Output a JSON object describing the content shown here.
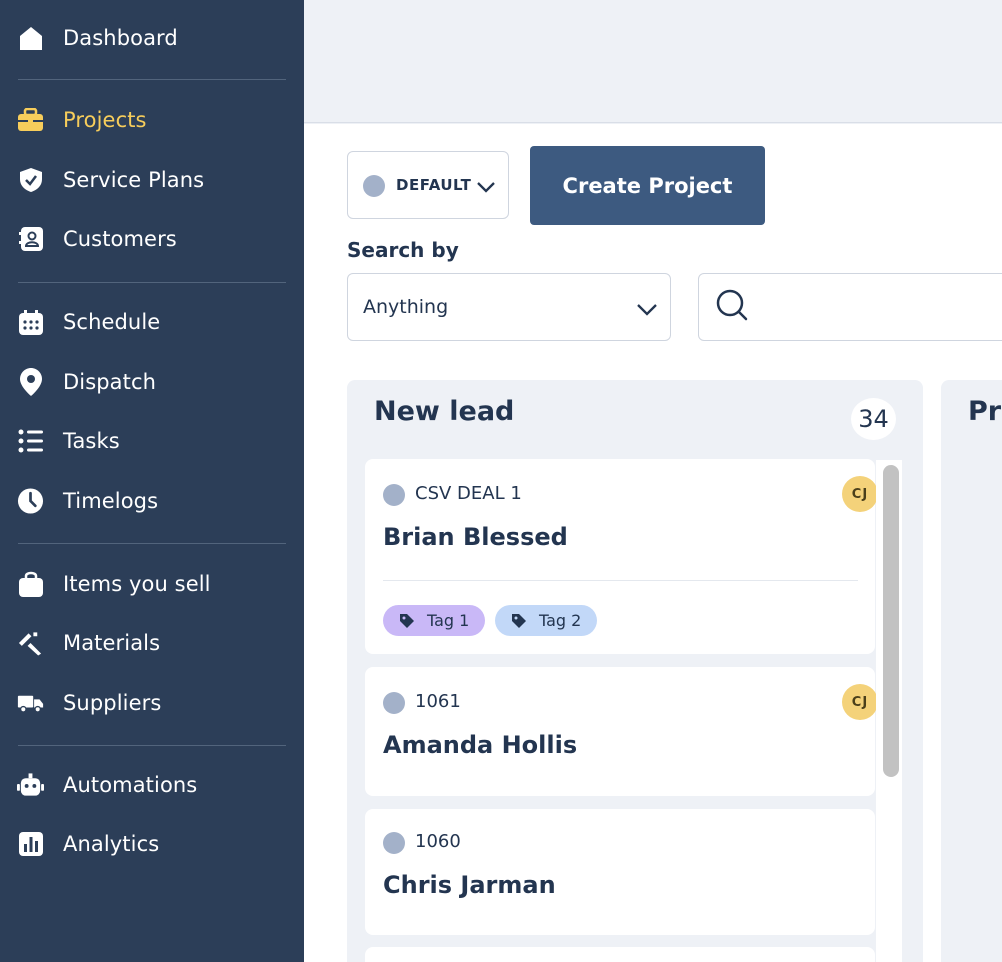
{
  "sidebar": {
    "items": [
      {
        "label": "Dashboard",
        "icon": "house-icon"
      },
      {
        "label": "Projects",
        "icon": "briefcase-icon",
        "active": true
      },
      {
        "label": "Service Plans",
        "icon": "shield-check-icon"
      },
      {
        "label": "Customers",
        "icon": "contact-book-icon"
      },
      {
        "label": "Schedule",
        "icon": "calendar-icon"
      },
      {
        "label": "Dispatch",
        "icon": "map-pin-icon"
      },
      {
        "label": "Tasks",
        "icon": "checklist-icon"
      },
      {
        "label": "Timelogs",
        "icon": "clock-icon"
      },
      {
        "label": "Items you sell",
        "icon": "shopping-bag-icon"
      },
      {
        "label": "Materials",
        "icon": "tools-icon"
      },
      {
        "label": "Suppliers",
        "icon": "truck-icon"
      },
      {
        "label": "Automations",
        "icon": "robot-icon"
      },
      {
        "label": "Analytics",
        "icon": "bar-chart-icon"
      }
    ]
  },
  "toolbar": {
    "filter_label": "DEFAULT",
    "create_label": "Create Project"
  },
  "search": {
    "label": "Search by",
    "field_value": "Anything",
    "query": ""
  },
  "board": {
    "columns": [
      {
        "title": "New lead",
        "count": "34",
        "cards": [
          {
            "ref": "CSV DEAL 1",
            "name": "Brian Blessed",
            "assignee": "CJ",
            "tags": [
              "Tag 1",
              "Tag 2"
            ]
          },
          {
            "ref": "1061",
            "name": "Amanda Hollis",
            "assignee": "CJ",
            "tags": []
          },
          {
            "ref": "1060",
            "name": "Chris Jarman",
            "assignee": "",
            "tags": []
          }
        ]
      },
      {
        "title": "Pro"
      }
    ]
  },
  "colors": {
    "sidebar_bg": "#2c3e58",
    "active_accent": "#f7cd5b",
    "primary_button": "#3d5a80",
    "tag1_bg": "#c9b8f7",
    "tag2_bg": "#c2d8f8",
    "avatar_bg": "#f4d27a"
  }
}
